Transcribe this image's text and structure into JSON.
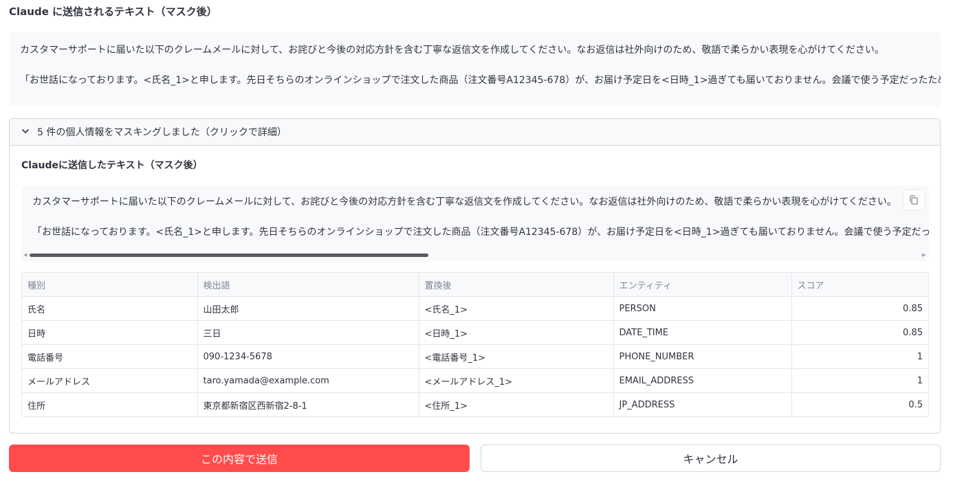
{
  "heading": "Claude に送信されるテキスト（マスク後）",
  "masked_text": {
    "line1": "カスタマーサポートに届いた以下のクレームメールに対して、お詫びと今後の対応方針を含む丁寧な返信文を作成してください。なお返信は社外向けのため、敬語で柔らかい表現を心がけてください。",
    "line2": "「お世話になっております。<氏名_1>と申します。先日そちらのオンラインショップで注文した商品（注文番号A12345-678）が、お届け予定日を<日時_1>過ぎても届いておりません。会議で使う予定だったため"
  },
  "expander": {
    "title": "5 件の個人情報をマスキングしました（クリックで詳細）",
    "sub_heading": "Claudeに送信したテキスト（マスク後）",
    "code_line1": "カスタマーサポートに届いた以下のクレームメールに対して、お詫びと今後の対応方針を含む丁寧な返信文を作成してください。なお返信は社外向けのため、敬語で柔らかい表現を心がけてください。",
    "code_line2": "「お世話になっております。<氏名_1>と申します。先日そちらのオンラインショップで注文した商品（注文番号A12345-678）が、お届け予定日を<日時_1>過ぎても届いておりません。会議で使う予定だったため",
    "copy_icon": "copy-icon",
    "table": {
      "headers": [
        "種別",
        "検出語",
        "置換後",
        "エンティティ",
        "スコア"
      ],
      "rows": [
        [
          "氏名",
          "山田太郎",
          "<氏名_1>",
          "PERSON",
          "0.85"
        ],
        [
          "日時",
          "三日",
          "<日時_1>",
          "DATE_TIME",
          "0.85"
        ],
        [
          "電話番号",
          "090-1234-5678",
          "<電話番号_1>",
          "PHONE_NUMBER",
          "1"
        ],
        [
          "メールアドレス",
          "taro.yamada@example.com",
          "<メールアドレス_1>",
          "EMAIL_ADDRESS",
          "1"
        ],
        [
          "住所",
          "東京都新宿区西新宿2-8-1",
          "<住所_1>",
          "JP_ADDRESS",
          "0.5"
        ]
      ]
    }
  },
  "buttons": {
    "send": "この内容で送信",
    "cancel": "キャンセル"
  },
  "colors": {
    "primary": "#ff4b4b",
    "code_bg": "#f8f9fb",
    "border": "#d6d6d9"
  }
}
